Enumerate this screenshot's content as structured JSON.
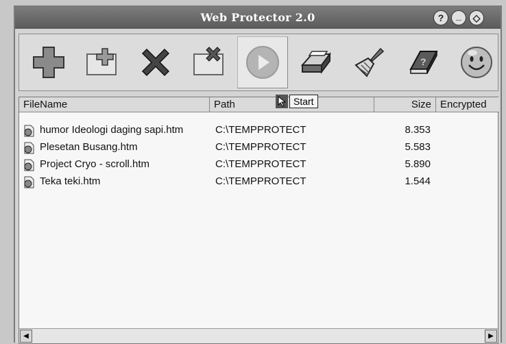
{
  "window": {
    "title": "Web Protector 2.0"
  },
  "titlebar_buttons": [
    {
      "name": "help",
      "glyph": "?"
    },
    {
      "name": "minimize",
      "glyph": "_"
    },
    {
      "name": "close",
      "glyph": "◇"
    }
  ],
  "toolbar": {
    "tools": [
      {
        "name": "add",
        "icon": "plus-icon"
      },
      {
        "name": "add-folder",
        "icon": "add-folder-icon"
      },
      {
        "name": "remove",
        "icon": "x-icon"
      },
      {
        "name": "remove-folder",
        "icon": "remove-folder-icon"
      },
      {
        "name": "start",
        "icon": "play-icon"
      },
      {
        "name": "printer",
        "icon": "printer-icon"
      },
      {
        "name": "clear",
        "icon": "broom-icon"
      },
      {
        "name": "help-book",
        "icon": "help-book-icon"
      },
      {
        "name": "about",
        "icon": "smiley-icon"
      }
    ]
  },
  "tooltip": {
    "text": "Start"
  },
  "list": {
    "columns": [
      "FileName",
      "Path",
      "Size",
      "Encrypted"
    ],
    "rows": [
      {
        "file": "humor Ideologi daging sapi.htm",
        "path": "C:\\TEMPPROTECT",
        "size": "8.353",
        "encrypted": ""
      },
      {
        "file": "Plesetan Busang.htm",
        "path": "C:\\TEMPPROTECT",
        "size": "5.583",
        "encrypted": ""
      },
      {
        "file": "Project Cryo - scroll.htm",
        "path": "C:\\TEMPPROTECT",
        "size": "5.890",
        "encrypted": ""
      },
      {
        "file": "Teka teki.htm",
        "path": "C:\\TEMPPROTECT",
        "size": "1.544",
        "encrypted": ""
      }
    ]
  }
}
